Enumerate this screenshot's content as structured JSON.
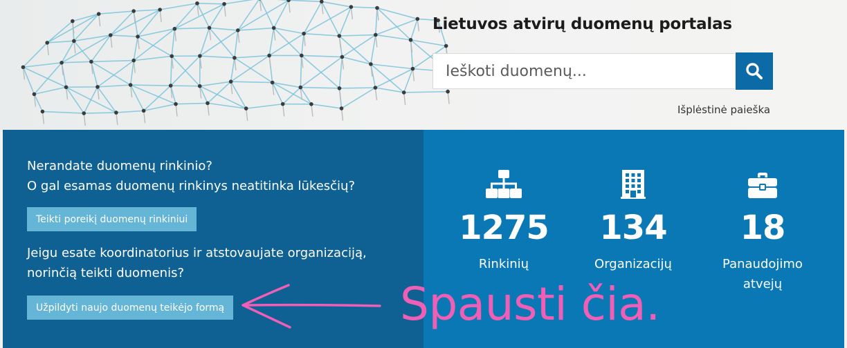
{
  "header": {
    "title": "Lietuvos atvirų duomenų portalas",
    "search_placeholder": "Ieškoti duomenų...",
    "advanced_search_label": "Išplėstinė paieška"
  },
  "left_panel": {
    "question_line1": "Nerandate duomenų rinkinio?",
    "question_line2": "O gal esamas duomenų rinkinys neatitinka lūkesčių?",
    "request_button_label": "Teikti poreikį duomenų rinkiniui",
    "coordinator_line1": "Jeigu esate koordinatorius ir atstovaujate organizaciją,",
    "coordinator_line2": "norinčią teikti duomenis?",
    "form_button_label": "Užpildyti naujo duomenų teikėjo formą"
  },
  "stats": [
    {
      "icon": "sitemap-icon",
      "value": "1275",
      "label_line1": "Rinkinių",
      "label_line2": ""
    },
    {
      "icon": "building-icon",
      "value": "134",
      "label_line1": "Organizacijų",
      "label_line2": ""
    },
    {
      "icon": "briefcase-icon",
      "value": "18",
      "label_line1": "Panaudojimo",
      "label_line2": "atvejų"
    }
  ],
  "annotation": {
    "text": "Spausti čia.",
    "color": "#ee5fb5"
  },
  "colors": {
    "left_panel": "#0e6192",
    "right_panel": "#0a78b4",
    "search_button": "#0c6aa6",
    "light_button": "#64b5d6"
  }
}
